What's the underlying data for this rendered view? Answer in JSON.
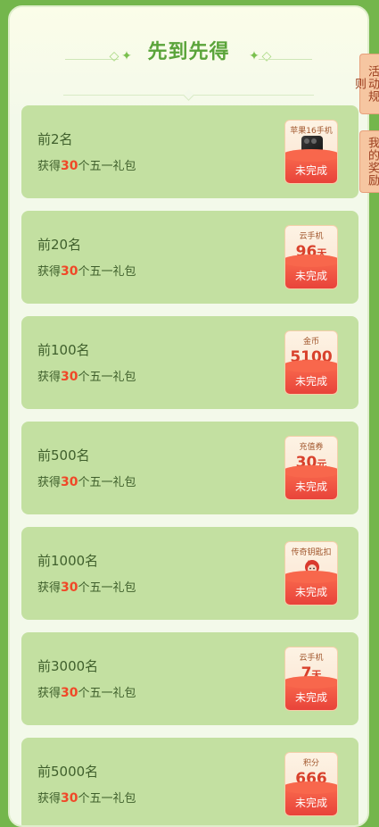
{
  "header": {
    "title": "先到先得"
  },
  "side_tabs": {
    "rules": "活动规则",
    "rewards": "我的奖励"
  },
  "desc": {
    "prefix": "获得",
    "number": "30",
    "suffix": "个五一礼包"
  },
  "cards": [
    {
      "rank": "前2名",
      "reward_label": "苹果16手机",
      "reward_value": "",
      "reward_unit": "",
      "status": "未完成"
    },
    {
      "rank": "前20名",
      "reward_label": "云手机",
      "reward_value": "96",
      "reward_unit": "天",
      "status": "未完成"
    },
    {
      "rank": "前100名",
      "reward_label": "金币",
      "reward_value": "5100",
      "reward_unit": "",
      "status": "未完成"
    },
    {
      "rank": "前500名",
      "reward_label": "充值券",
      "reward_value": "30",
      "reward_unit": "元",
      "status": "未完成"
    },
    {
      "rank": "前1000名",
      "reward_label": "传奇钥匙扣",
      "reward_value": "",
      "reward_unit": "",
      "status": "未完成"
    },
    {
      "rank": "前3000名",
      "reward_label": "云手机",
      "reward_value": "7",
      "reward_unit": "天",
      "status": "未完成"
    },
    {
      "rank": "前5000名",
      "reward_label": "积分",
      "reward_value": "666",
      "reward_unit": "",
      "status": "未完成"
    }
  ],
  "colors": {
    "background": "#74b64c",
    "card": "#c3e0a1",
    "accent": "#f04828",
    "title": "#5aa43a"
  }
}
